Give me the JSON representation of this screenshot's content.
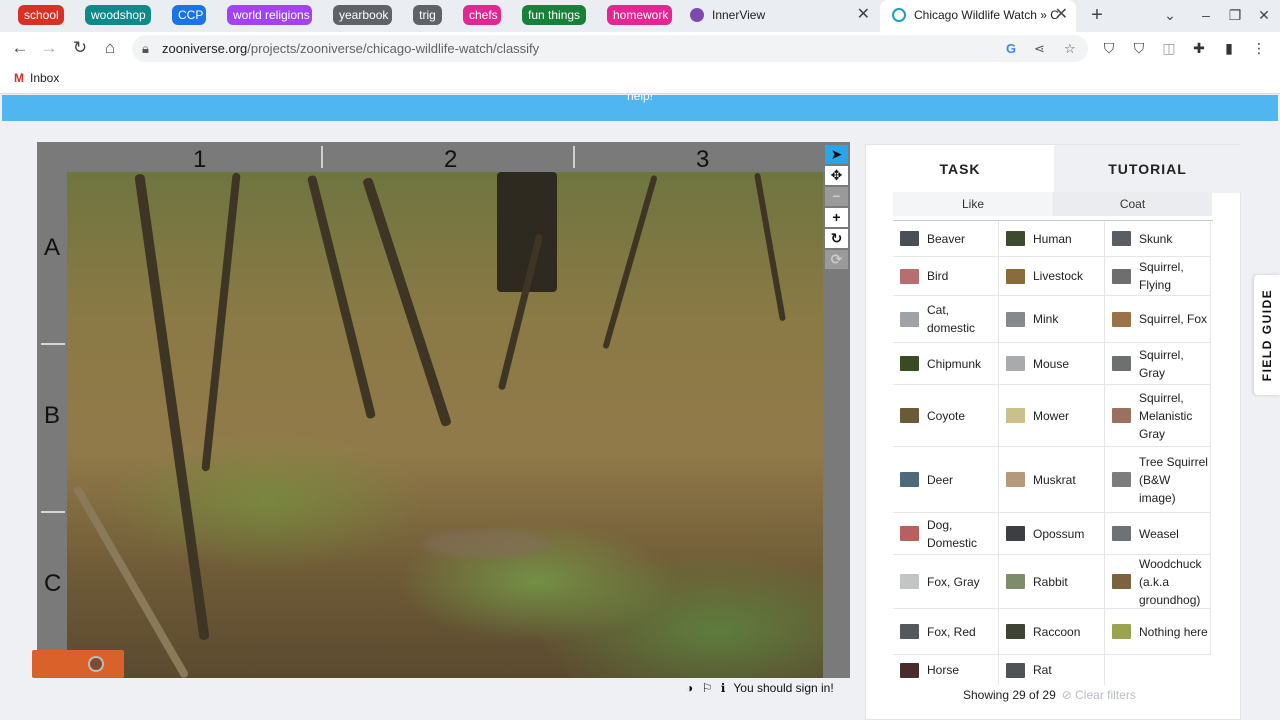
{
  "tab_groups": [
    {
      "label": "school",
      "color": "#d93025"
    },
    {
      "label": "woodshop",
      "color": "#0f8a8a"
    },
    {
      "label": "CCP",
      "color": "#1a73e8"
    },
    {
      "label": "world religions",
      "color": "#a142f4"
    },
    {
      "label": "yearbook",
      "color": "#5f6368"
    },
    {
      "label": "trig",
      "color": "#5f6368"
    },
    {
      "label": "chefs",
      "color": "#e52592"
    },
    {
      "label": "fun things",
      "color": "#188038"
    },
    {
      "label": "homework",
      "color": "#e52592"
    }
  ],
  "tabs": [
    {
      "title": "InnerView",
      "icon": "innerview-favicon-icon"
    },
    {
      "title": "Chicago Wildlife Watch » C",
      "icon": "zooniverse-favicon-icon",
      "active": true
    }
  ],
  "toolbar": {
    "url_host": "zooniverse.org",
    "url_path": "/projects/zooniverse/chicago-wildlife-watch/classify"
  },
  "bookmarks": {
    "inbox": "Inbox"
  },
  "help_bar": {
    "text": "help!"
  },
  "grid": {
    "columns": [
      "1",
      "2",
      "3"
    ],
    "rows": [
      "A",
      "B",
      "C"
    ]
  },
  "meta": {
    "sign_in": "You should sign in!"
  },
  "panel": {
    "tabs": {
      "task": "TASK",
      "tutorial": "TUTORIAL"
    },
    "filters": {
      "like": "Like",
      "coat": "Coat"
    },
    "species": [
      {
        "name": "Beaver",
        "thumb": "#4a4f55"
      },
      {
        "name": "Human",
        "thumb": "#3e4a2e"
      },
      {
        "name": "Skunk",
        "thumb": "#5a5e62"
      },
      {
        "name": "Bird",
        "thumb": "#b56f6f"
      },
      {
        "name": "Livestock",
        "thumb": "#8a6b3b"
      },
      {
        "name": "Squirrel, Flying",
        "thumb": "#6e6e6e"
      },
      {
        "name": "Cat, domestic",
        "thumb": "#9fa3a7"
      },
      {
        "name": "Mink",
        "thumb": "#85898c"
      },
      {
        "name": "Squirrel, Fox",
        "thumb": "#9a7248"
      },
      {
        "name": "Chipmunk",
        "thumb": "#3a4a22"
      },
      {
        "name": "Mouse",
        "thumb": "#a8aaac"
      },
      {
        "name": "Squirrel, Gray",
        "thumb": "#6d6f70"
      },
      {
        "name": "Coyote",
        "thumb": "#6b5a36"
      },
      {
        "name": "Mower",
        "thumb": "#c9c08a"
      },
      {
        "name": "Squirrel, Melanistic Gray",
        "thumb": "#9a7060"
      },
      {
        "name": "Deer",
        "thumb": "#4e6a7a"
      },
      {
        "name": "Muskrat",
        "thumb": "#b49a7a"
      },
      {
        "name": "Tree Squirrel (B&W image)",
        "thumb": "#7d7d7d"
      },
      {
        "name": "Dog, Domestic",
        "thumb": "#b86060"
      },
      {
        "name": "Opossum",
        "thumb": "#3c3f42"
      },
      {
        "name": "Weasel",
        "thumb": "#6f7275"
      },
      {
        "name": "Fox, Gray",
        "thumb": "#c2c4c6"
      },
      {
        "name": "Rabbit",
        "thumb": "#7e8c6a"
      },
      {
        "name": "Woodchuck (a.k.a groundhog)",
        "thumb": "#7a6440"
      },
      {
        "name": "Fox, Red",
        "thumb": "#55595d"
      },
      {
        "name": "Raccoon",
        "thumb": "#3e4336"
      },
      {
        "name": "Nothing here",
        "thumb": "#9aa44e"
      },
      {
        "name": "Horse",
        "thumb": "#4a2a2a"
      },
      {
        "name": "Rat",
        "thumb": "#505356"
      }
    ],
    "showing": "Showing 29 of 29",
    "clear_filters": "Clear filters"
  },
  "field_guide": {
    "label": "FIELD GUIDE"
  }
}
